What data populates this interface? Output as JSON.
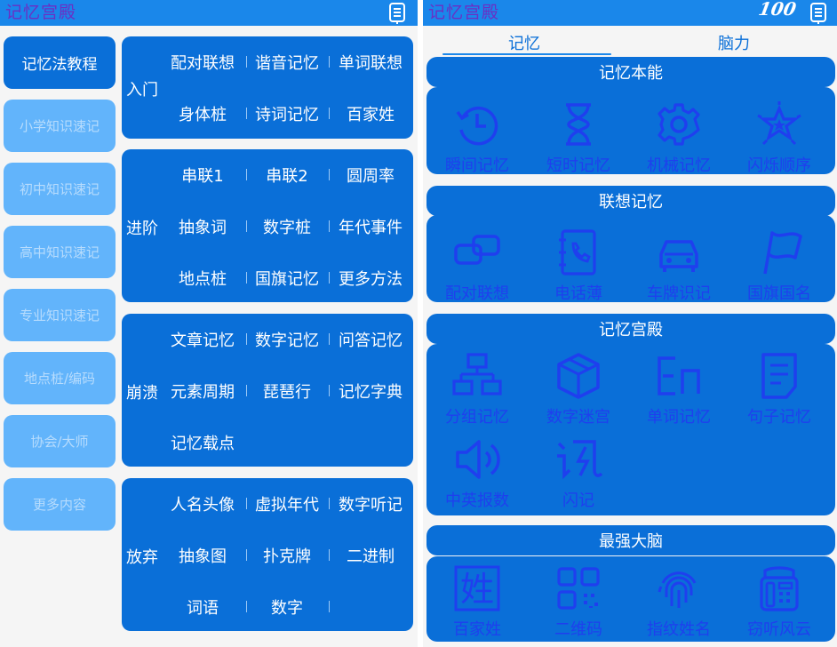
{
  "left": {
    "app_title": "记忆宫殿",
    "sidebar": [
      {
        "label": "记忆法教程",
        "active": true
      },
      {
        "label": "小学知识速记",
        "active": false
      },
      {
        "label": "初中知识速记",
        "active": false
      },
      {
        "label": "高中知识速记",
        "active": false
      },
      {
        "label": "专业知识速记",
        "active": false
      },
      {
        "label": "地点桩/编码",
        "active": false
      },
      {
        "label": "协会/大师",
        "active": false
      },
      {
        "label": "更多内容",
        "active": false
      }
    ],
    "cards": [
      {
        "level": "入门",
        "rows": [
          [
            "配对联想",
            "谐音记忆",
            "单词联想"
          ],
          [
            "身体桩",
            "诗词记忆",
            "百家姓"
          ]
        ]
      },
      {
        "level": "进阶",
        "rows": [
          [
            "串联1",
            "串联2",
            "圆周率"
          ],
          [
            "抽象词",
            "数字桩",
            "年代事件"
          ],
          [
            "地点桩",
            "国旗记忆",
            "更多方法"
          ]
        ]
      },
      {
        "level": "崩溃",
        "rows": [
          [
            "文章记忆",
            "数字记忆",
            "问答记忆"
          ],
          [
            "元素周期",
            "琵琶行",
            "记忆字典"
          ],
          [
            "记忆载点"
          ]
        ]
      },
      {
        "level": "放弃",
        "rows": [
          [
            "人名头像",
            "虚拟年代",
            "数字听记"
          ],
          [
            "抽象图",
            "扑克牌",
            "二进制"
          ],
          [
            "词语",
            "数字"
          ]
        ]
      }
    ]
  },
  "right": {
    "app_title": "记忆宫殿",
    "logo_text": "100",
    "tabs": [
      "记忆",
      "脑力"
    ],
    "sections": [
      {
        "title": "记忆本能",
        "items": [
          {
            "label": "瞬间记忆",
            "icon": "history-clock-icon"
          },
          {
            "label": "短时记忆",
            "icon": "hourglass-icon"
          },
          {
            "label": "机械记忆",
            "icon": "gear-icon"
          },
          {
            "label": "闪烁顺序",
            "icon": "sparkle-star-icon"
          }
        ]
      },
      {
        "title": "联想记忆",
        "items": [
          {
            "label": "配对联想",
            "icon": "link-icon"
          },
          {
            "label": "电话薄",
            "icon": "phonebook-icon"
          },
          {
            "label": "车牌识记",
            "icon": "car-icon"
          },
          {
            "label": "国旗国名",
            "icon": "flag-icon"
          }
        ]
      },
      {
        "title": "记忆宫殿",
        "items": [
          {
            "label": "分组记忆",
            "icon": "org-chart-icon"
          },
          {
            "label": "数字迷宫",
            "icon": "cube-icon"
          },
          {
            "label": "单词记忆",
            "icon": "letters-en-icon"
          },
          {
            "label": "句子记忆",
            "icon": "document-icon"
          },
          {
            "label": "中英报数",
            "icon": "speaker-icon"
          },
          {
            "label": "闪记",
            "icon": "flash-memo-icon"
          }
        ]
      },
      {
        "title": "最强大脑",
        "items": [
          {
            "label": "百家姓",
            "icon": "surname-char-icon"
          },
          {
            "label": "二维码",
            "icon": "qr-code-icon"
          },
          {
            "label": "指纹姓名",
            "icon": "fingerprint-icon"
          },
          {
            "label": "窃听风云",
            "icon": "desk-phone-icon"
          }
        ]
      }
    ],
    "surname_char": "姓",
    "colors": {
      "primary": "#0a6fd8",
      "appbar": "#1a87ea",
      "side_inactive": "#62b4fb",
      "icon": "#1f3fee",
      "title": "#6b2fc4"
    }
  }
}
